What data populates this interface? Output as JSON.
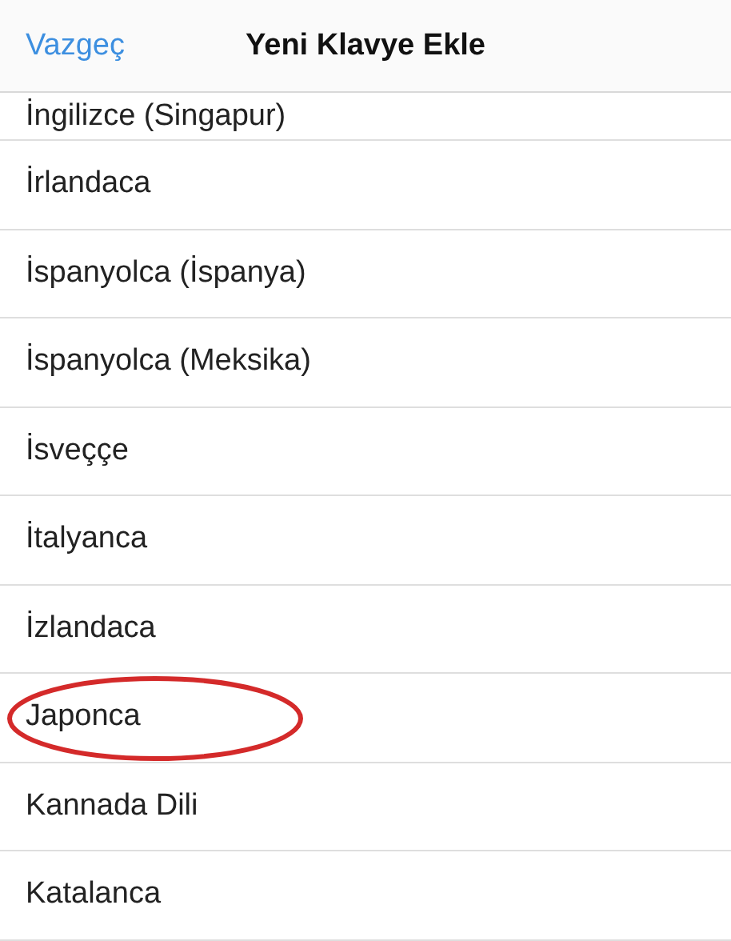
{
  "nav_bar": {
    "cancel": "Vazgeç",
    "title": "Yeni Klavye Ekle"
  },
  "rows": [
    {
      "label": "İngilizce (Singapur)",
      "circled": false
    },
    {
      "label": "İrlandaca",
      "circled": false
    },
    {
      "label": "İspanyolca (İspanya)",
      "circled": false
    },
    {
      "label": "İspanyolca (Meksika)",
      "circled": false
    },
    {
      "label": "İsveççe",
      "circled": false
    },
    {
      "label": "İtalyanca",
      "circled": false
    },
    {
      "label": "İzlandaca",
      "circled": false
    },
    {
      "label": "Japonca",
      "circled": true
    },
    {
      "label": "Kannada Dili",
      "circled": false
    },
    {
      "label": "Katalanca",
      "circled": false
    }
  ]
}
